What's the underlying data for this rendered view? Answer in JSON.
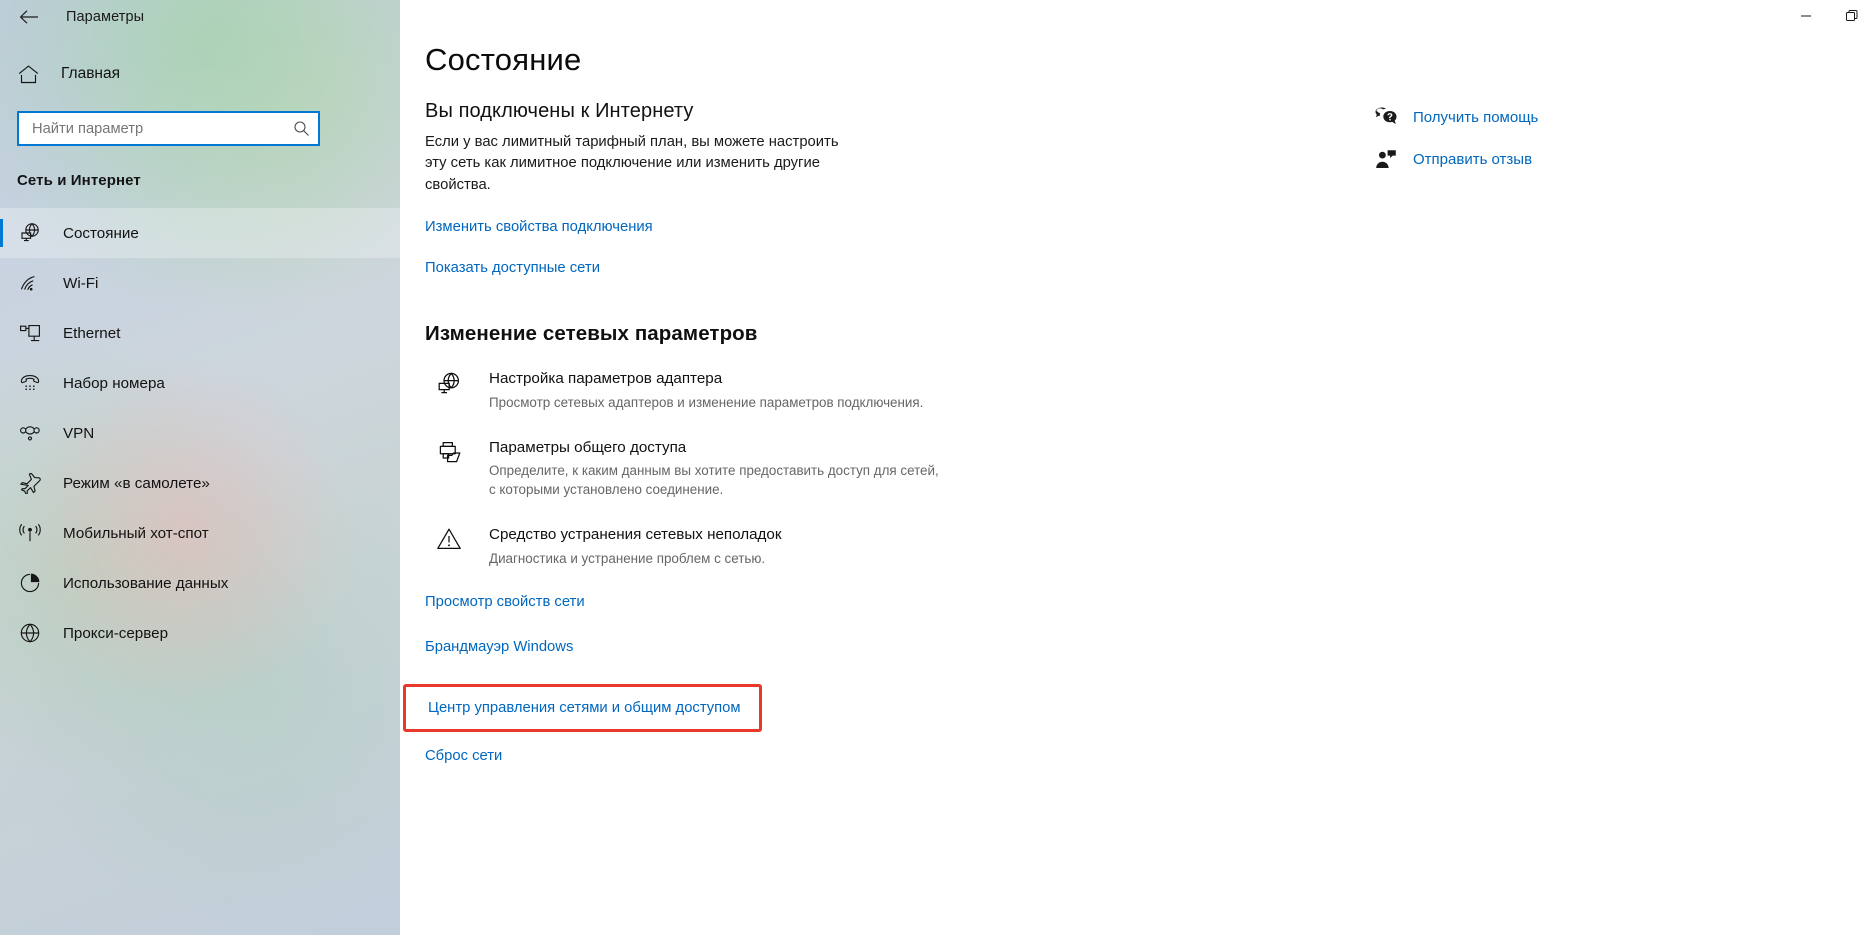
{
  "window": {
    "title": "Параметры",
    "back_icon": "back-arrow-icon",
    "minimize_label": "—",
    "restore_label": "❐"
  },
  "sidebar": {
    "home": {
      "label": "Главная",
      "icon": "home-icon"
    },
    "search": {
      "value": "",
      "placeholder": "Найти параметр",
      "icon": "search-icon"
    },
    "section_header": "Сеть и Интернет",
    "items": [
      {
        "label": "Состояние",
        "icon": "globe-monitor-icon",
        "selected": true
      },
      {
        "label": "Wi-Fi",
        "icon": "wifi-icon",
        "selected": false
      },
      {
        "label": "Ethernet",
        "icon": "ethernet-icon",
        "selected": false
      },
      {
        "label": "Набор номера",
        "icon": "dialup-phone-icon",
        "selected": false
      },
      {
        "label": "VPN",
        "icon": "vpn-icon",
        "selected": false
      },
      {
        "label": "Режим «в самолете»",
        "icon": "airplane-icon",
        "selected": false
      },
      {
        "label": "Мобильный хот-спот",
        "icon": "hotspot-icon",
        "selected": false
      },
      {
        "label": "Использование данных",
        "icon": "data-usage-pie-icon",
        "selected": false
      },
      {
        "label": "Прокси-сервер",
        "icon": "proxy-globe-icon",
        "selected": false
      }
    ]
  },
  "main": {
    "page_title": "Состояние",
    "status_title": "Вы подключены к Интернету",
    "status_desc": "Если у вас лимитный тарифный план, вы можете настроить эту сеть как лимитное подключение или изменить другие свойства.",
    "link_change_properties": "Изменить свойства подключения",
    "link_show_networks": "Показать доступные сети",
    "settings_header": "Изменение сетевых параметров",
    "options": [
      {
        "title": "Настройка параметров адаптера",
        "sub": "Просмотр сетевых адаптеров и изменение параметров подключения.",
        "icon": "adapter-globe-icon"
      },
      {
        "title": "Параметры общего доступа",
        "sub": "Определите, к каким данным вы хотите предоставить доступ для сетей, с которыми установлено соединение.",
        "icon": "sharing-printer-folder-icon"
      },
      {
        "title": "Средство устранения сетевых неполадок",
        "sub": "Диагностика и устранение проблем с сетью.",
        "icon": "warning-triangle-icon"
      }
    ],
    "bottom_links": [
      {
        "label": "Просмотр свойств сети",
        "highlighted": false
      },
      {
        "label": "Брандмауэр Windows",
        "highlighted": false
      },
      {
        "label": "Центр управления сетями и общим доступом",
        "highlighted": true
      },
      {
        "label": "Сброс сети",
        "highlighted": false
      }
    ]
  },
  "right_rail": [
    {
      "label": "Получить помощь",
      "icon": "help-question-bubble-icon"
    },
    {
      "label": "Отправить отзыв",
      "icon": "feedback-person-icon"
    }
  ],
  "colors": {
    "accent_blue": "#0078d4",
    "link_blue": "#0067c0",
    "highlight_red": "#e8382a",
    "sidebar_base": "#c7d2e0"
  }
}
